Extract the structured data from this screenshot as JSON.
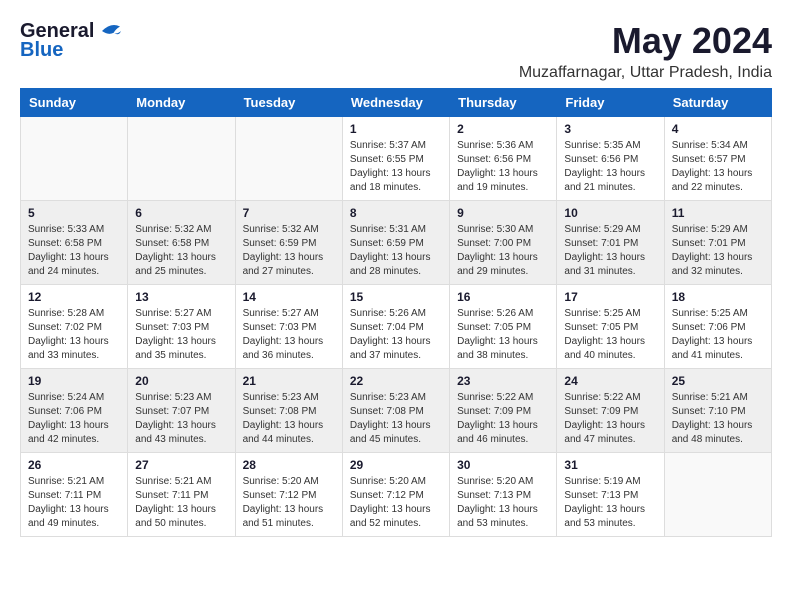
{
  "header": {
    "logo_general": "General",
    "logo_blue": "Blue",
    "title": "May 2024",
    "subtitle": "Muzaffarnagar, Uttar Pradesh, India"
  },
  "weekdays": [
    "Sunday",
    "Monday",
    "Tuesday",
    "Wednesday",
    "Thursday",
    "Friday",
    "Saturday"
  ],
  "weeks": [
    [
      {
        "day": "",
        "info": ""
      },
      {
        "day": "",
        "info": ""
      },
      {
        "day": "",
        "info": ""
      },
      {
        "day": "1",
        "info": "Sunrise: 5:37 AM\nSunset: 6:55 PM\nDaylight: 13 hours and 18 minutes."
      },
      {
        "day": "2",
        "info": "Sunrise: 5:36 AM\nSunset: 6:56 PM\nDaylight: 13 hours and 19 minutes."
      },
      {
        "day": "3",
        "info": "Sunrise: 5:35 AM\nSunset: 6:56 PM\nDaylight: 13 hours and 21 minutes."
      },
      {
        "day": "4",
        "info": "Sunrise: 5:34 AM\nSunset: 6:57 PM\nDaylight: 13 hours and 22 minutes."
      }
    ],
    [
      {
        "day": "5",
        "info": "Sunrise: 5:33 AM\nSunset: 6:58 PM\nDaylight: 13 hours and 24 minutes."
      },
      {
        "day": "6",
        "info": "Sunrise: 5:32 AM\nSunset: 6:58 PM\nDaylight: 13 hours and 25 minutes."
      },
      {
        "day": "7",
        "info": "Sunrise: 5:32 AM\nSunset: 6:59 PM\nDaylight: 13 hours and 27 minutes."
      },
      {
        "day": "8",
        "info": "Sunrise: 5:31 AM\nSunset: 6:59 PM\nDaylight: 13 hours and 28 minutes."
      },
      {
        "day": "9",
        "info": "Sunrise: 5:30 AM\nSunset: 7:00 PM\nDaylight: 13 hours and 29 minutes."
      },
      {
        "day": "10",
        "info": "Sunrise: 5:29 AM\nSunset: 7:01 PM\nDaylight: 13 hours and 31 minutes."
      },
      {
        "day": "11",
        "info": "Sunrise: 5:29 AM\nSunset: 7:01 PM\nDaylight: 13 hours and 32 minutes."
      }
    ],
    [
      {
        "day": "12",
        "info": "Sunrise: 5:28 AM\nSunset: 7:02 PM\nDaylight: 13 hours and 33 minutes."
      },
      {
        "day": "13",
        "info": "Sunrise: 5:27 AM\nSunset: 7:03 PM\nDaylight: 13 hours and 35 minutes."
      },
      {
        "day": "14",
        "info": "Sunrise: 5:27 AM\nSunset: 7:03 PM\nDaylight: 13 hours and 36 minutes."
      },
      {
        "day": "15",
        "info": "Sunrise: 5:26 AM\nSunset: 7:04 PM\nDaylight: 13 hours and 37 minutes."
      },
      {
        "day": "16",
        "info": "Sunrise: 5:26 AM\nSunset: 7:05 PM\nDaylight: 13 hours and 38 minutes."
      },
      {
        "day": "17",
        "info": "Sunrise: 5:25 AM\nSunset: 7:05 PM\nDaylight: 13 hours and 40 minutes."
      },
      {
        "day": "18",
        "info": "Sunrise: 5:25 AM\nSunset: 7:06 PM\nDaylight: 13 hours and 41 minutes."
      }
    ],
    [
      {
        "day": "19",
        "info": "Sunrise: 5:24 AM\nSunset: 7:06 PM\nDaylight: 13 hours and 42 minutes."
      },
      {
        "day": "20",
        "info": "Sunrise: 5:23 AM\nSunset: 7:07 PM\nDaylight: 13 hours and 43 minutes."
      },
      {
        "day": "21",
        "info": "Sunrise: 5:23 AM\nSunset: 7:08 PM\nDaylight: 13 hours and 44 minutes."
      },
      {
        "day": "22",
        "info": "Sunrise: 5:23 AM\nSunset: 7:08 PM\nDaylight: 13 hours and 45 minutes."
      },
      {
        "day": "23",
        "info": "Sunrise: 5:22 AM\nSunset: 7:09 PM\nDaylight: 13 hours and 46 minutes."
      },
      {
        "day": "24",
        "info": "Sunrise: 5:22 AM\nSunset: 7:09 PM\nDaylight: 13 hours and 47 minutes."
      },
      {
        "day": "25",
        "info": "Sunrise: 5:21 AM\nSunset: 7:10 PM\nDaylight: 13 hours and 48 minutes."
      }
    ],
    [
      {
        "day": "26",
        "info": "Sunrise: 5:21 AM\nSunset: 7:11 PM\nDaylight: 13 hours and 49 minutes."
      },
      {
        "day": "27",
        "info": "Sunrise: 5:21 AM\nSunset: 7:11 PM\nDaylight: 13 hours and 50 minutes."
      },
      {
        "day": "28",
        "info": "Sunrise: 5:20 AM\nSunset: 7:12 PM\nDaylight: 13 hours and 51 minutes."
      },
      {
        "day": "29",
        "info": "Sunrise: 5:20 AM\nSunset: 7:12 PM\nDaylight: 13 hours and 52 minutes."
      },
      {
        "day": "30",
        "info": "Sunrise: 5:20 AM\nSunset: 7:13 PM\nDaylight: 13 hours and 53 minutes."
      },
      {
        "day": "31",
        "info": "Sunrise: 5:19 AM\nSunset: 7:13 PM\nDaylight: 13 hours and 53 minutes."
      },
      {
        "day": "",
        "info": ""
      }
    ]
  ]
}
